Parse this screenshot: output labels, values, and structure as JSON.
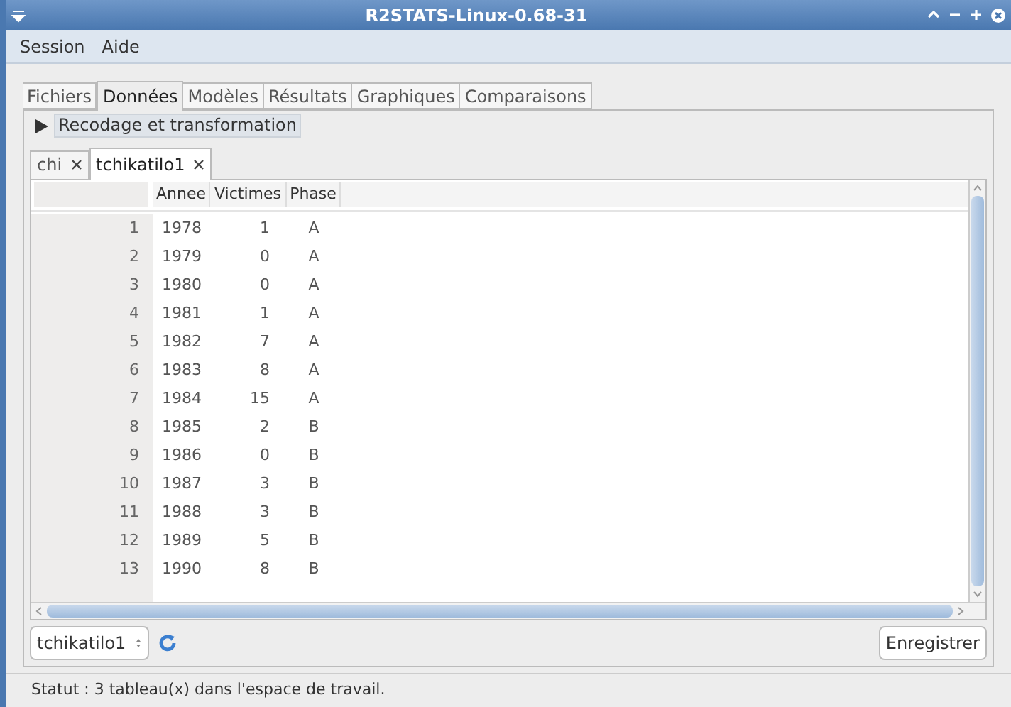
{
  "window": {
    "title": "R2STATS-Linux-0.68-31",
    "menu": [
      "Session",
      "Aide"
    ]
  },
  "tabs": [
    {
      "label": "Fichiers",
      "selected": false
    },
    {
      "label": "Données",
      "selected": true
    },
    {
      "label": "Modèles",
      "selected": false
    },
    {
      "label": "Résultats",
      "selected": false
    },
    {
      "label": "Graphiques",
      "selected": false
    },
    {
      "label": "Comparaisons",
      "selected": false
    }
  ],
  "expander": {
    "label": "Recodage et transformation",
    "expanded": false
  },
  "data_tabs": [
    {
      "label": "chi",
      "selected": false
    },
    {
      "label": "tchikatilo1",
      "selected": true
    }
  ],
  "table": {
    "columns": [
      "Annee",
      "Victimes",
      "Phase"
    ],
    "rows": [
      {
        "index": "1",
        "cells": [
          "1978",
          "1",
          "A"
        ]
      },
      {
        "index": "2",
        "cells": [
          "1979",
          "0",
          "A"
        ]
      },
      {
        "index": "3",
        "cells": [
          "1980",
          "0",
          "A"
        ]
      },
      {
        "index": "4",
        "cells": [
          "1981",
          "1",
          "A"
        ]
      },
      {
        "index": "5",
        "cells": [
          "1982",
          "7",
          "A"
        ]
      },
      {
        "index": "6",
        "cells": [
          "1983",
          "8",
          "A"
        ]
      },
      {
        "index": "7",
        "cells": [
          "1984",
          "15",
          "A"
        ]
      },
      {
        "index": "8",
        "cells": [
          "1985",
          "2",
          "B"
        ]
      },
      {
        "index": "9",
        "cells": [
          "1986",
          "0",
          "B"
        ]
      },
      {
        "index": "10",
        "cells": [
          "1987",
          "3",
          "B"
        ]
      },
      {
        "index": "11",
        "cells": [
          "1988",
          "3",
          "B"
        ]
      },
      {
        "index": "12",
        "cells": [
          "1989",
          "5",
          "B"
        ]
      },
      {
        "index": "13",
        "cells": [
          "1990",
          "8",
          "B"
        ]
      }
    ]
  },
  "dataset_select": {
    "value": "tchikatilo1"
  },
  "save_button": "Enregistrer",
  "status_bar": "Statut : 3 tableau(x) dans l'espace de travail."
}
